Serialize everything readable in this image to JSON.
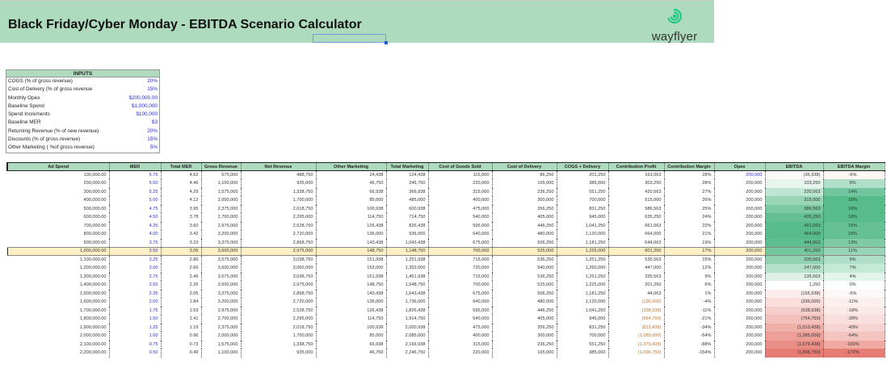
{
  "header": {
    "title": "Black Friday/Cyber Monday - EBITDA Scenario Calculator",
    "logo_text": "wayflyer",
    "logo_icon": "spiral-icon",
    "brand_color": "#1fc98a",
    "banner_color": "#aedbbd"
  },
  "inputs": {
    "title": "INPUTS",
    "items": [
      {
        "label": "COGS (% of gross revenue)",
        "value": "20%"
      },
      {
        "label": "Cost of Delivery (% of gross revenue",
        "value": "15%"
      },
      {
        "label": "Monthly Opex",
        "value": "$200,000.00"
      },
      {
        "label": "Baseline Spend",
        "value": "$1,000,000"
      },
      {
        "label": "Spend Increments",
        "value": "$100,000"
      },
      {
        "label": "Baseline MER",
        "value": "$3"
      },
      {
        "label": "Returning Revenue (% of new revenue)",
        "value": "20%"
      },
      {
        "label": "Discounts (% of gross revenue)",
        "value": "15%"
      },
      {
        "label": "Other Marketing ( %of gross revenue)",
        "value": "5%"
      }
    ]
  },
  "table": {
    "columns": [
      "Ad Spend",
      "MER",
      "Total MER",
      "Gross Revenue",
      "Net Revenue",
      "Other Marketing",
      "Total Marketing",
      "Cost of Goods Sold",
      "Cost of Delivery",
      "COGS + Delivery",
      "Contribution Profit",
      "Contribution Margin",
      "Opex",
      "EBITDA",
      "EBITDA Margin"
    ],
    "baseline_row": 9,
    "colors": {
      "positive": "#57bb8a",
      "negative": "#e67c73",
      "baseline": "#fdf0c4"
    },
    "rows": [
      [
        "100,000.00",
        "5.75",
        "4.62",
        "575,000",
        "488,750",
        "24,438",
        "124,438",
        "115,000",
        "86,250",
        "201,250",
        "163,063",
        "28%",
        "200,000",
        "(36,938)",
        "-6%"
      ],
      [
        "200,000.00",
        "5.50",
        "4.46",
        "1,100,000",
        "935,000",
        "46,750",
        "246,750",
        "220,000",
        "165,000",
        "385,000",
        "303,250",
        "28%",
        "200,000",
        "103,250",
        "9%"
      ],
      [
        "300,000.00",
        "5.25",
        "4.29",
        "1,575,000",
        "1,338,750",
        "66,938",
        "366,938",
        "315,000",
        "236,250",
        "551,250",
        "420,563",
        "27%",
        "200,000",
        "220,563",
        "14%"
      ],
      [
        "400,000.00",
        "5.00",
        "4.12",
        "2,000,000",
        "1,700,000",
        "85,000",
        "485,000",
        "400,000",
        "300,000",
        "700,000",
        "515,000",
        "26%",
        "200,000",
        "315,000",
        "16%"
      ],
      [
        "500,000.00",
        "4.75",
        "3.95",
        "2,375,000",
        "2,018,750",
        "100,938",
        "600,938",
        "475,000",
        "356,250",
        "831,250",
        "586,563",
        "25%",
        "200,000",
        "386,563",
        "16%"
      ],
      [
        "600,000.00",
        "4.50",
        "3.78",
        "2,700,000",
        "2,295,000",
        "114,750",
        "714,750",
        "540,000",
        "405,000",
        "945,000",
        "635,250",
        "24%",
        "200,000",
        "435,250",
        "16%"
      ],
      [
        "700,000.00",
        "4.25",
        "3.60",
        "2,975,000",
        "2,528,750",
        "126,438",
        "826,438",
        "595,000",
        "446,250",
        "1,041,250",
        "661,063",
        "22%",
        "200,000",
        "461,063",
        "15%"
      ],
      [
        "800,000.00",
        "4.00",
        "3.42",
        "3,200,000",
        "2,720,000",
        "136,000",
        "936,000",
        "640,000",
        "480,000",
        "1,120,000",
        "664,000",
        "21%",
        "200,000",
        "464,000",
        "15%"
      ],
      [
        "900,000.00",
        "3.75",
        "3.23",
        "3,375,000",
        "2,868,750",
        "143,438",
        "1,043,438",
        "675,000",
        "506,250",
        "1,181,250",
        "644,063",
        "19%",
        "200,000",
        "444,063",
        "13%"
      ],
      [
        "1,000,000.00",
        "3.50",
        "3.05",
        "3,500,000",
        "2,975,000",
        "148,750",
        "1,148,750",
        "700,000",
        "525,000",
        "1,225,000",
        "601,250",
        "17%",
        "200,000",
        "401,250",
        "11%"
      ],
      [
        "1,100,000.00",
        "3.25",
        "2.86",
        "3,575,000",
        "3,038,750",
        "151,938",
        "1,251,938",
        "715,000",
        "536,250",
        "1,251,250",
        "535,563",
        "15%",
        "200,000",
        "335,563",
        "9%"
      ],
      [
        "1,200,000.00",
        "3.00",
        "2.66",
        "3,600,000",
        "3,060,000",
        "153,000",
        "1,353,000",
        "720,000",
        "540,000",
        "1,260,000",
        "447,000",
        "12%",
        "200,000",
        "247,000",
        "7%"
      ],
      [
        "1,300,000.00",
        "2.75",
        "2.46",
        "3,575,000",
        "3,038,750",
        "151,938",
        "1,451,938",
        "715,000",
        "536,250",
        "1,251,250",
        "335,563",
        "9%",
        "200,000",
        "135,563",
        "4%"
      ],
      [
        "1,400,000.00",
        "2.50",
        "2.26",
        "3,500,000",
        "2,975,000",
        "148,750",
        "1,548,750",
        "700,000",
        "525,000",
        "1,225,000",
        "201,250",
        "6%",
        "200,000",
        "1,250",
        "0%"
      ],
      [
        "1,500,000.00",
        "2.25",
        "2.05",
        "3,375,000",
        "2,868,750",
        "143,438",
        "1,643,438",
        "675,000",
        "506,250",
        "1,181,250",
        "44,063",
        "1%",
        "200,000",
        "(155,938)",
        "-5%"
      ],
      [
        "1,600,000.00",
        "2.00",
        "1.84",
        "3,200,000",
        "2,720,000",
        "136,000",
        "1,736,000",
        "640,000",
        "480,000",
        "1,120,000",
        "(136,000)",
        "-4%",
        "200,000",
        "(336,000)",
        "-11%"
      ],
      [
        "1,700,000.00",
        "1.75",
        "1.63",
        "2,975,000",
        "2,528,750",
        "126,438",
        "1,826,438",
        "595,000",
        "446,250",
        "1,041,250",
        "(338,938)",
        "-11%",
        "200,000",
        "(538,938)",
        "-18%"
      ],
      [
        "1,800,000.00",
        "1.50",
        "1.41",
        "2,700,000",
        "2,295,000",
        "114,750",
        "1,914,750",
        "540,000",
        "405,000",
        "945,000",
        "(564,750)",
        "-21%",
        "200,000",
        "(764,750)",
        "-28%"
      ],
      [
        "1,900,000.00",
        "1.25",
        "1.19",
        "2,375,000",
        "2,018,750",
        "100,938",
        "2,000,938",
        "475,000",
        "356,250",
        "831,250",
        "(813,438)",
        "-34%",
        "200,000",
        "(1,013,438)",
        "-43%"
      ],
      [
        "2,000,000.00",
        "1.00",
        "0.96",
        "2,000,000",
        "1,700,000",
        "85,000",
        "2,085,000",
        "400,000",
        "300,000",
        "700,000",
        "(1,085,000)",
        "-54%",
        "200,000",
        "(1,285,000)",
        "-64%"
      ],
      [
        "2,100,000.00",
        "0.75",
        "0.73",
        "1,575,000",
        "1,338,750",
        "66,938",
        "2,166,938",
        "315,000",
        "236,250",
        "551,250",
        "(1,379,438)",
        "-88%",
        "200,000",
        "(1,579,438)",
        "-100%"
      ],
      [
        "2,200,000.00",
        "0.50",
        "0.49",
        "1,100,000",
        "935,000",
        "46,750",
        "2,246,750",
        "220,000",
        "165,000",
        "385,000",
        "(1,696,750)",
        "-154%",
        "200,000",
        "(1,896,750)",
        "-172%"
      ]
    ]
  }
}
